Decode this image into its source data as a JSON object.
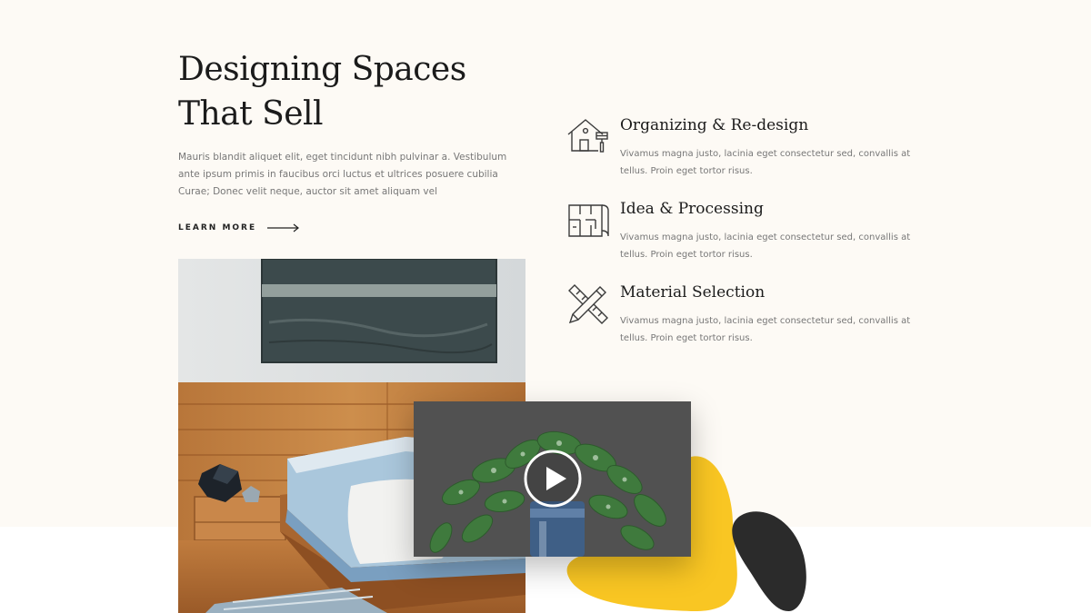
{
  "hero": {
    "title_line1": "Designing Spaces",
    "title_line2": "That Sell",
    "description": "Mauris blandit aliquet elit, eget tincidunt nibh pulvinar a. Vestibulum ante ipsum primis in faucibus orci luctus et ultrices posuere cubilia Curae; Donec velit neque, auctor sit amet aliquam vel",
    "learn_more_label": "LEARN MORE",
    "arrow_icon": "arrow-right-icon"
  },
  "services": [
    {
      "title": "Organizing & Re-design",
      "description": "Vivamus magna justo, lacinia eget consectetur sed, convallis at tellus. Proin eget tortor risus.",
      "icon": "house-paint-icon"
    },
    {
      "title": "Idea & Processing",
      "description": "Vivamus magna justo, lacinia eget consectetur sed, convallis at tellus. Proin eget tortor risus.",
      "icon": "blueprint-icon"
    },
    {
      "title": "Material Selection",
      "description": "Vivamus magna justo, lacinia eget consectetur sed, convallis at tellus. Proin eget tortor risus.",
      "icon": "pencil-ruler-icon"
    }
  ],
  "media": {
    "bedroom_image": "bedroom-photo",
    "video_thumbnail": "plant-photo",
    "play_icon": "play-icon"
  },
  "colors": {
    "background": "#fdfaf5",
    "accent_yellow": "#f9c623",
    "accent_dark": "#2b2b2b",
    "heading": "#1b1b1b",
    "body_text": "#777777"
  }
}
